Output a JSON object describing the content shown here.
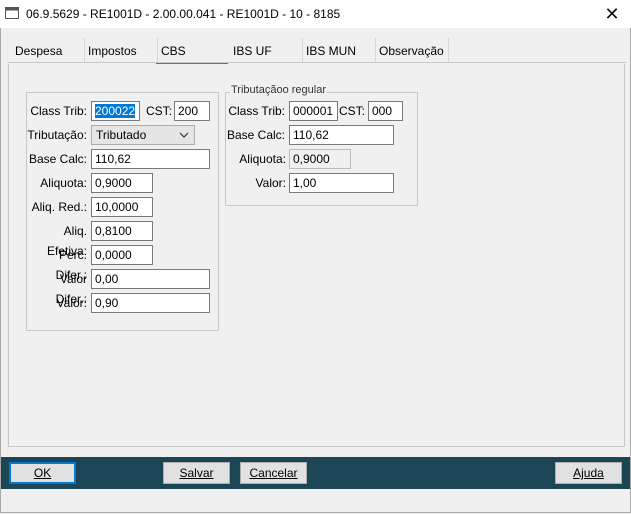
{
  "window": {
    "title": "06.9.5629 - RE1001D - 2.00.00.041 - RE1001D - 10 - 8185",
    "close_glyph": "✕"
  },
  "tabs": [
    {
      "label": "Despesa"
    },
    {
      "label": "Impostos"
    },
    {
      "label": "CBS",
      "active": true
    },
    {
      "label": "IBS UF"
    },
    {
      "label": "IBS MUN"
    },
    {
      "label": "Observação"
    }
  ],
  "cbs": {
    "class_trib_label": "Class Trib:",
    "class_trib_value": "200022",
    "cst_label": "CST:",
    "cst_value": "200",
    "tributacao_label": "Tributação:",
    "tributacao_value": "Tributado",
    "base_calc_label": "Base Calc:",
    "base_calc_value": "110,62",
    "aliquota_label": "Aliquota:",
    "aliquota_value": "0,9000",
    "aliq_red_label": "Aliq. Red.:",
    "aliq_red_value": "10,0000",
    "aliq_efetiva_label": "Aliq. Efetiva:",
    "aliq_efetiva_value": "0,8100",
    "perc_difer_label": "Perc. Difer.:",
    "perc_difer_value": "0,0000",
    "valor_difer_label": "Valor Difer.:",
    "valor_difer_value": "0,00",
    "valor_label": "Valor:",
    "valor_value": "0,90"
  },
  "regular": {
    "group_title": "Tributaçãoo regular",
    "class_trib_label": "Class Trib:",
    "class_trib_value": "000001",
    "cst_label": "CST:",
    "cst_value": "000",
    "base_calc_label": "Base Calc:",
    "base_calc_value": "110,62",
    "aliquota_label": "Aliquota:",
    "aliquota_value": "0,9000",
    "valor_label": "Valor:",
    "valor_value": "1,00"
  },
  "footer": {
    "ok_label": "OK",
    "salvar_label": "Salvar",
    "cancelar_label": "Cancelar",
    "ajuda_label": "Ajuda",
    "bar_color": "#1c4555"
  },
  "colors": {
    "accent": "#1e88c8",
    "selection": "#0078d7"
  }
}
